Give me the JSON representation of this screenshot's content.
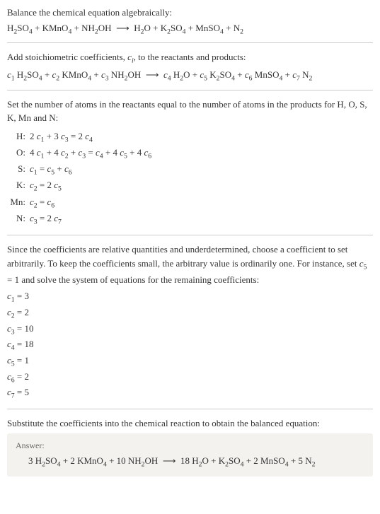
{
  "intro": {
    "line1": "Balance the chemical equation algebraically:",
    "equation_html": "H<sub>2</sub>SO<sub>4</sub> + KMnO<sub>4</sub> + NH<sub>2</sub>OH &nbsp;⟶&nbsp; H<sub>2</sub>O + K<sub>2</sub>SO<sub>4</sub> + MnSO<sub>4</sub> + N<sub>2</sub>"
  },
  "step_add": {
    "text_html": "Add stoichiometric coefficients, <span class='ital'>c<sub>i</sub></span>, to the reactants and products:",
    "equation_html": "<span class='ital'>c</span><sub>1</sub> H<sub>2</sub>SO<sub>4</sub> + <span class='ital'>c</span><sub>2</sub> KMnO<sub>4</sub> + <span class='ital'>c</span><sub>3</sub> NH<sub>2</sub>OH &nbsp;⟶&nbsp; <span class='ital'>c</span><sub>4</sub> H<sub>2</sub>O + <span class='ital'>c</span><sub>5</sub> K<sub>2</sub>SO<sub>4</sub> + <span class='ital'>c</span><sub>6</sub> MnSO<sub>4</sub> + <span class='ital'>c</span><sub>7</sub> N<sub>2</sub>"
  },
  "step_atoms": {
    "text_html": "Set the number of atoms in the reactants equal to the number of atoms in the products for H, O, S, K, Mn and N:",
    "rows": [
      {
        "label": "H:",
        "eq_html": "2 <span class='ital'>c</span><sub>1</sub> + 3 <span class='ital'>c</span><sub>3</sub> = 2 <span class='ital'>c</span><sub>4</sub>"
      },
      {
        "label": "O:",
        "eq_html": "4 <span class='ital'>c</span><sub>1</sub> + 4 <span class='ital'>c</span><sub>2</sub> + <span class='ital'>c</span><sub>3</sub> = <span class='ital'>c</span><sub>4</sub> + 4 <span class='ital'>c</span><sub>5</sub> + 4 <span class='ital'>c</span><sub>6</sub>"
      },
      {
        "label": "S:",
        "eq_html": "<span class='ital'>c</span><sub>1</sub> = <span class='ital'>c</span><sub>5</sub> + <span class='ital'>c</span><sub>6</sub>"
      },
      {
        "label": "K:",
        "eq_html": "<span class='ital'>c</span><sub>2</sub> = 2 <span class='ital'>c</span><sub>5</sub>"
      },
      {
        "label": "Mn:",
        "eq_html": "<span class='ital'>c</span><sub>2</sub> = <span class='ital'>c</span><sub>6</sub>"
      },
      {
        "label": "N:",
        "eq_html": "<span class='ital'>c</span><sub>3</sub> = 2 <span class='ital'>c</span><sub>7</sub>"
      }
    ]
  },
  "step_solve": {
    "text_html": "Since the coefficients are relative quantities and underdetermined, choose a coefficient to set arbitrarily. To keep the coefficients small, the arbitrary value is ordinarily one. For instance, set <span class='ital'>c</span><sub>5</sub> = 1 and solve the system of equations for the remaining coefficients:",
    "coeffs": [
      {
        "html": "<span class='ital'>c</span><sub>1</sub> = 3"
      },
      {
        "html": "<span class='ital'>c</span><sub>2</sub> = 2"
      },
      {
        "html": "<span class='ital'>c</span><sub>3</sub> = 10"
      },
      {
        "html": "<span class='ital'>c</span><sub>4</sub> = 18"
      },
      {
        "html": "<span class='ital'>c</span><sub>5</sub> = 1"
      },
      {
        "html": "<span class='ital'>c</span><sub>6</sub> = 2"
      },
      {
        "html": "<span class='ital'>c</span><sub>7</sub> = 5"
      }
    ]
  },
  "step_sub": {
    "text_html": "Substitute the coefficients into the chemical reaction to obtain the balanced equation:"
  },
  "answer": {
    "label": "Answer:",
    "equation_html": "3 H<sub>2</sub>SO<sub>4</sub> + 2 KMnO<sub>4</sub> + 10 NH<sub>2</sub>OH &nbsp;⟶&nbsp; 18 H<sub>2</sub>O + K<sub>2</sub>SO<sub>4</sub> + 2 MnSO<sub>4</sub> + 5 N<sub>2</sub>"
  }
}
